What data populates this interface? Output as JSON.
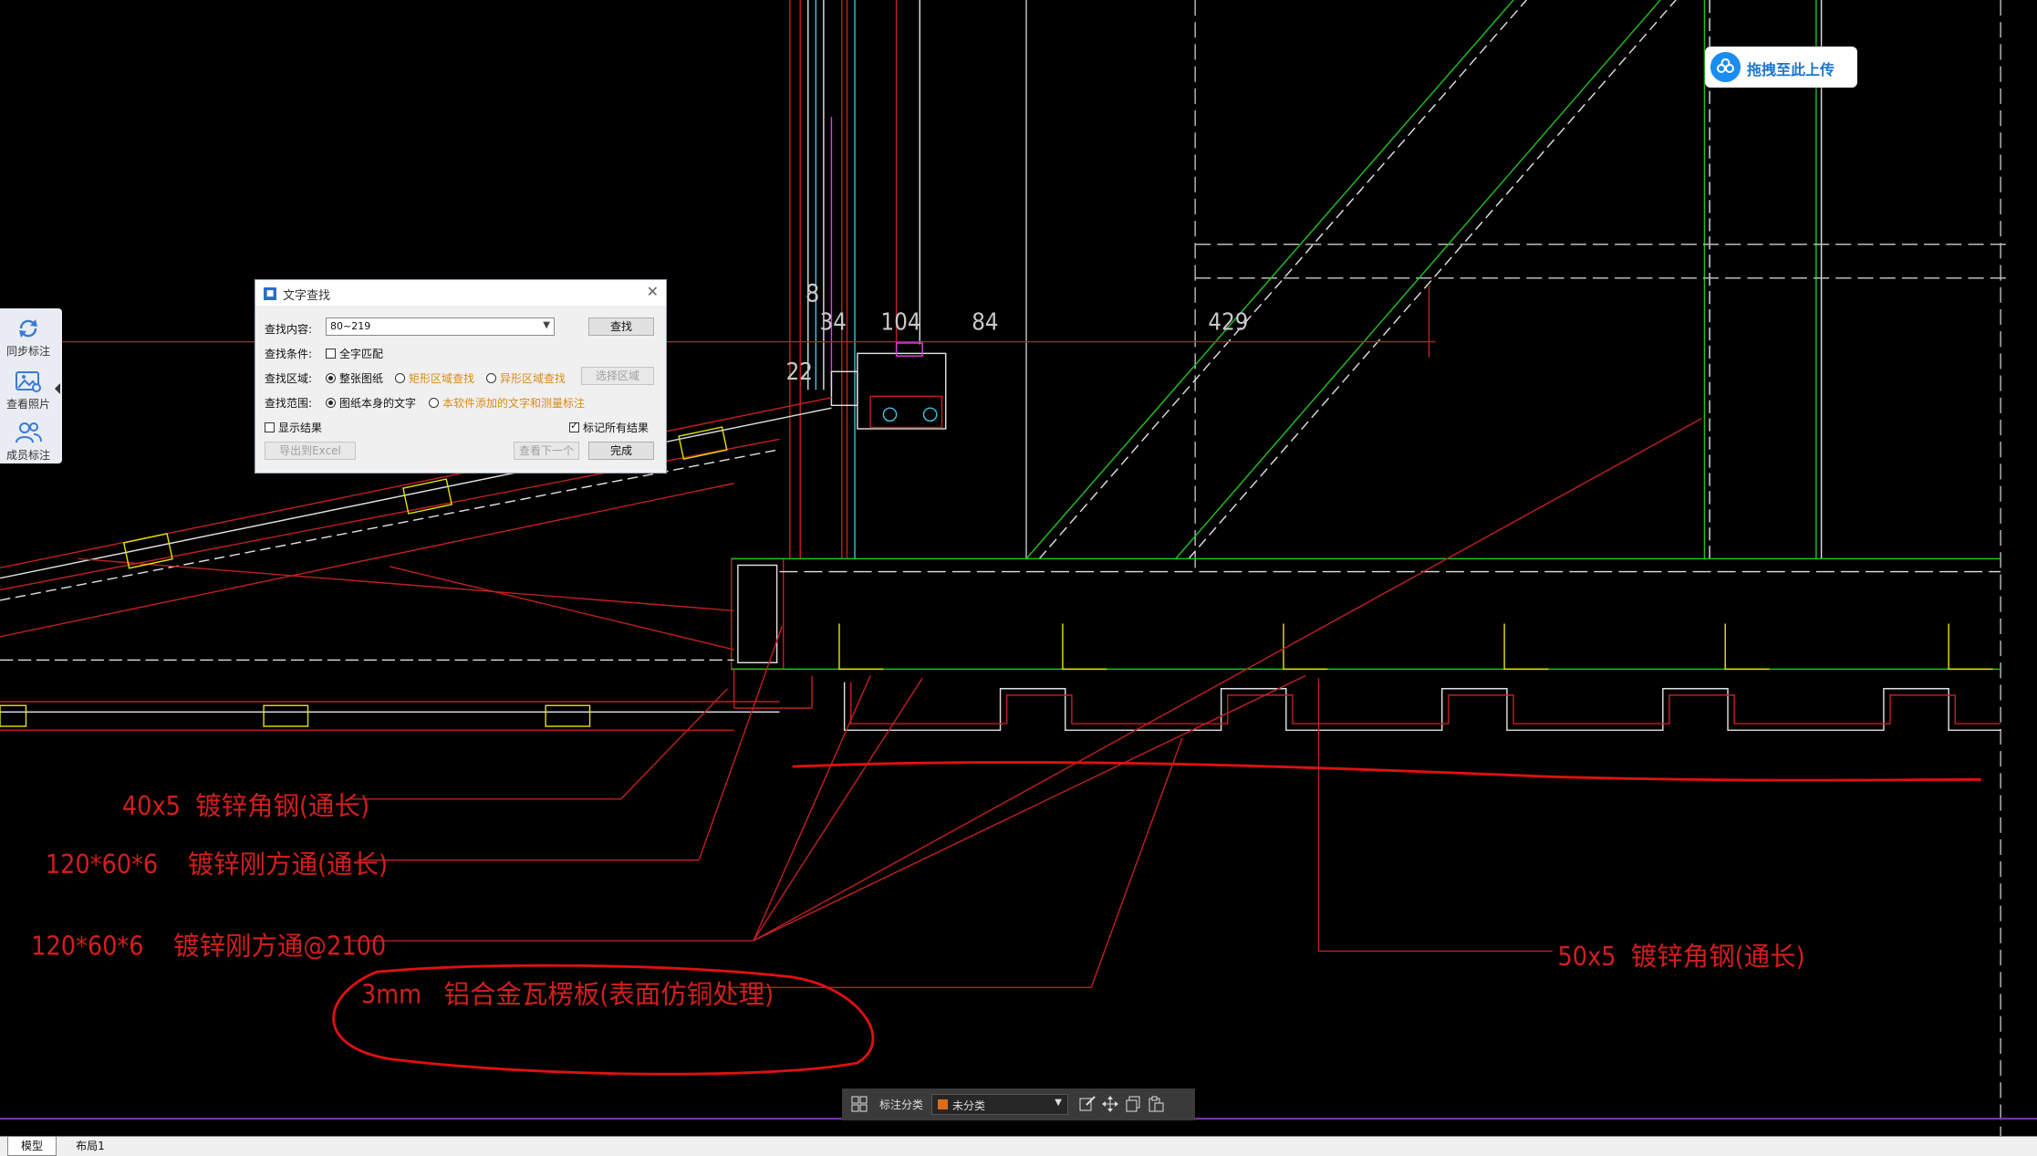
{
  "drawing": {
    "dimensions": [
      "8",
      "34",
      "104",
      "84",
      "429",
      "22"
    ],
    "annotations": [
      "40x5  镀锌角钢(通长)",
      "120*60*6    镀锌刚方通(通长)",
      "120*60*6    镀锌刚方通@2100",
      "3mm   铝合金瓦楞板(表面仿铜处理)",
      "50x5  镀锌角钢(通长)"
    ]
  },
  "left_toolbar": {
    "items": [
      {
        "label": "同步标注",
        "icon": "sync-icon"
      },
      {
        "label": "查看照片",
        "icon": "photo-icon"
      },
      {
        "label": "成员标注",
        "icon": "members-icon"
      }
    ]
  },
  "dialog": {
    "title": "文字查找",
    "search_label": "查找内容:",
    "search_value": "80~219",
    "search_button": "查找",
    "condition_label": "查找条件:",
    "whole_word": "全字匹配",
    "area_label": "查找区域:",
    "area_options": [
      "整张图纸",
      "矩形区域查找",
      "异形区域查找"
    ],
    "select_area_button": "选择区域",
    "scope_label": "查找范围:",
    "scope_options": [
      "图纸本身的文字",
      "本软件添加的文字和测量标注"
    ],
    "show_results": "显示结果",
    "mark_all": "标记所有结果",
    "export_button": "导出到Excel",
    "next_button": "查看下一个",
    "done_button": "完成"
  },
  "upload_badge": {
    "label": "拖拽至此上传"
  },
  "annotation_bar": {
    "label": "标注分类",
    "selected": "未分类",
    "swatch_color": "#e06b17"
  },
  "tabs": [
    "模型",
    "布局1"
  ]
}
